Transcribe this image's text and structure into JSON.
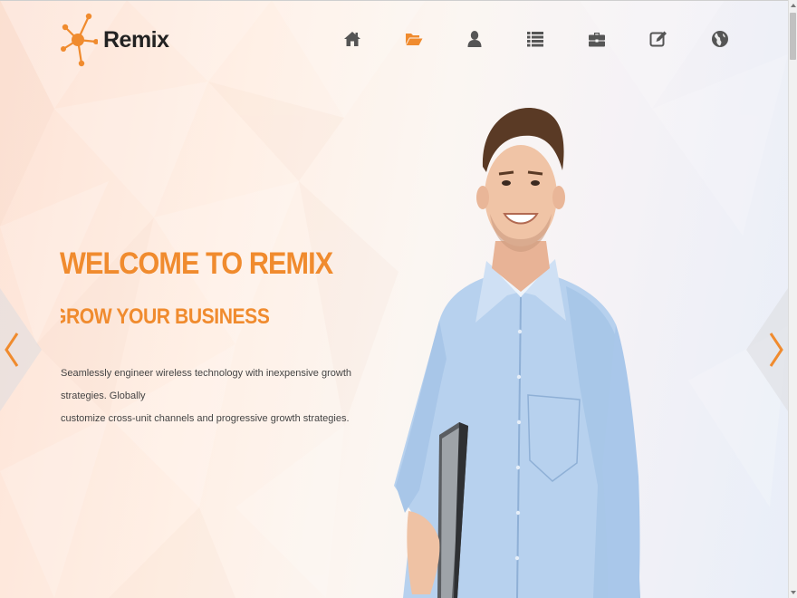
{
  "brand": {
    "name": "Remix",
    "logo_icon": "molecule-icon",
    "accent_color": "#f08b2e"
  },
  "nav": {
    "items": [
      {
        "icon": "home-icon",
        "active": false
      },
      {
        "icon": "folder-open-icon",
        "active": true
      },
      {
        "icon": "user-icon",
        "active": false
      },
      {
        "icon": "list-icon",
        "active": false
      },
      {
        "icon": "briefcase-icon",
        "active": false
      },
      {
        "icon": "edit-icon",
        "active": false
      },
      {
        "icon": "globe-icon",
        "active": false
      }
    ]
  },
  "hero": {
    "title": "WELCOME TO REMIX",
    "subtitle": "GROW YOUR BUSINESS",
    "description_line1": "Seamlessly engineer wireless technology with inexpensive growth strategies. Globally",
    "description_line2": "customize cross-unit channels and progressive growth strategies."
  },
  "slider": {
    "prev_icon": "chevron-left-icon",
    "next_icon": "chevron-right-icon"
  }
}
